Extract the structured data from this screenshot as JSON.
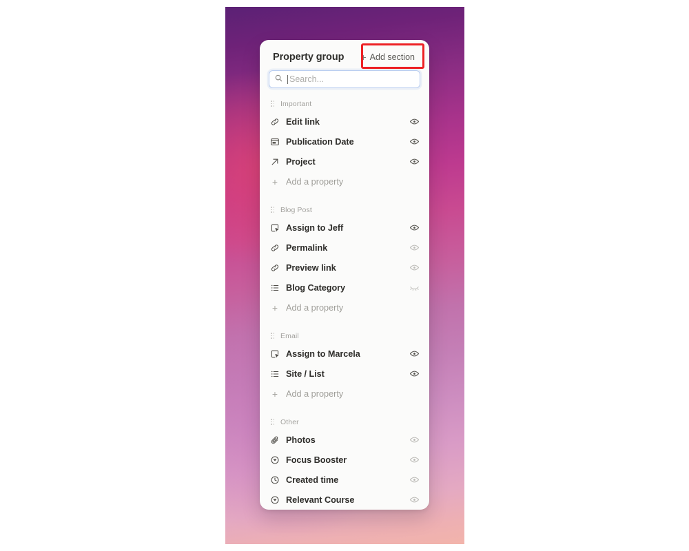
{
  "panel": {
    "title": "Property group",
    "add_section_label": "Add section",
    "add_section_icon": "plus-icon",
    "search": {
      "placeholder": "Search...",
      "value": "",
      "icon": "search-icon"
    },
    "add_property_label": "Add a property",
    "sections": [
      {
        "label": "Important",
        "drag_handle": "drag-handle-icon",
        "properties": [
          {
            "name": "Edit link",
            "icon": "link-icon",
            "visibility": "visible",
            "visibility_icon": "eye-icon"
          },
          {
            "name": "Publication Date",
            "icon": "date-icon",
            "visibility": "visible",
            "visibility_icon": "eye-icon"
          },
          {
            "name": "Project",
            "icon": "relation-icon",
            "visibility": "visible",
            "visibility_icon": "eye-icon"
          }
        ]
      },
      {
        "label": "Blog Post",
        "drag_handle": "drag-handle-icon",
        "properties": [
          {
            "name": "Assign to Jeff",
            "icon": "button-icon",
            "visibility": "visible",
            "visibility_icon": "eye-icon"
          },
          {
            "name": "Permalink",
            "icon": "link-icon",
            "visibility": "dimmed",
            "visibility_icon": "eye-icon"
          },
          {
            "name": "Preview link",
            "icon": "link-icon",
            "visibility": "dimmed",
            "visibility_icon": "eye-icon"
          },
          {
            "name": "Blog Category",
            "icon": "multiselect-icon",
            "visibility": "hidden",
            "visibility_icon": "eye-off-icon"
          }
        ]
      },
      {
        "label": "Email",
        "drag_handle": "drag-handle-icon",
        "properties": [
          {
            "name": "Assign to Marcela",
            "icon": "button-icon",
            "visibility": "visible",
            "visibility_icon": "eye-icon"
          },
          {
            "name": "Site / List",
            "icon": "multiselect-icon",
            "visibility": "visible",
            "visibility_icon": "eye-icon"
          }
        ]
      },
      {
        "label": "Other",
        "drag_handle": "drag-handle-icon",
        "show_add_property": false,
        "properties": [
          {
            "name": "Photos",
            "icon": "paperclip-icon",
            "visibility": "dimmed",
            "visibility_icon": "eye-icon"
          },
          {
            "name": "Focus Booster",
            "icon": "select-icon",
            "visibility": "dimmed",
            "visibility_icon": "eye-icon"
          },
          {
            "name": "Created time",
            "icon": "clock-icon",
            "visibility": "dimmed",
            "visibility_icon": "eye-icon"
          },
          {
            "name": "Relevant Course",
            "icon": "select-icon",
            "visibility": "dimmed",
            "visibility_icon": "eye-icon"
          }
        ]
      }
    ]
  },
  "annotation": {
    "target": "add-section-button",
    "color": "#ed2024"
  },
  "background": {
    "gradient_from": "#5b2175",
    "gradient_mid": "#c75f9d",
    "gradient_to": "#f2b4ab"
  }
}
